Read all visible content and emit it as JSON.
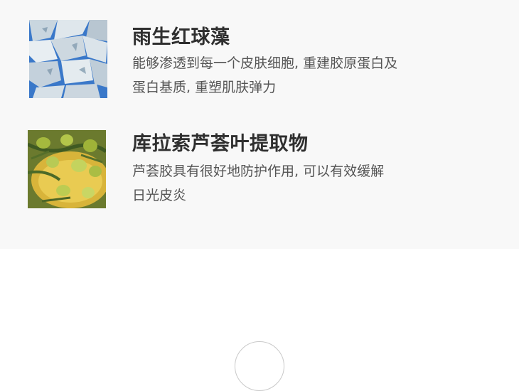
{
  "ingredients": [
    {
      "title": "雨生红球藻",
      "desc_line1": "能够渗透到每一个皮肤细胞, 重建胶原蛋白及",
      "desc_line2": "蛋白基质, 重塑肌肤弹力",
      "image_icon": "algae-crystal-image"
    },
    {
      "title": "库拉索芦荟叶提取物",
      "desc_line1": "芦荟胶具有很好地防护作用, 可以有效缓解",
      "desc_line2": "日光皮炎",
      "image_icon": "olive-oil-image"
    }
  ],
  "colors": {
    "panel_bg": "#f8f8f8",
    "title": "#2f2f2f",
    "desc": "#555555"
  }
}
